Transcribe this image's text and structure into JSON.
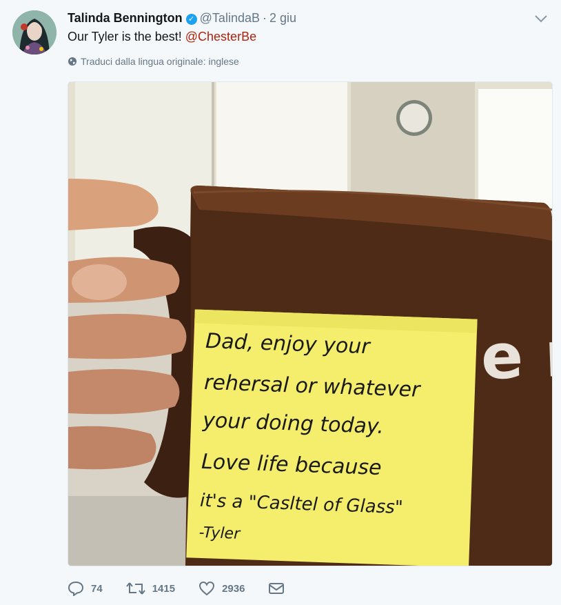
{
  "tweet": {
    "author_name": "Talinda Bennington",
    "handle": "@TalindaB",
    "separator": "·",
    "date": "2 giu",
    "text_prefix": "Our Tyler is the best!",
    "mention": "@ChesterBe",
    "translate_label": "Traduci dalla lingua originale: inglese",
    "verified_glyph": "✓",
    "note": {
      "lines": [
        "Dad, enjoy your",
        "rehersal or whatever",
        "your doing today.",
        "Love life because",
        "it's a \"Casltel of Glass\"",
        "-Tyler"
      ]
    },
    "mug_lettering": "e  ne  p"
  },
  "actions": {
    "reply_count": "74",
    "retweet_count": "1415",
    "like_count": "2936"
  },
  "colors": {
    "accent_link": "#b0220c",
    "verified": "#1da1f2",
    "muted": "#657786"
  },
  "icons": [
    "verified-icon",
    "chevron-down-icon",
    "globe-icon",
    "reply-icon",
    "retweet-icon",
    "like-icon",
    "message-icon"
  ]
}
